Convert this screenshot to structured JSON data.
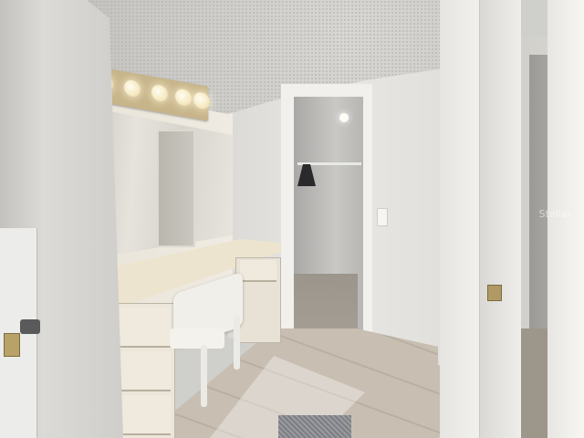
{
  "scene": {
    "description_type": "photo",
    "colors": {
      "ceiling": "#c9c8c4",
      "walls": "#e3e1dd",
      "vanity": "#ede4cf",
      "floor_tile": "#c6bdb0",
      "light_bar": "#c7b48a",
      "bulb_glow": "#fffdf2",
      "door_hardware": "#b8a26a"
    }
  },
  "overlay": {
    "watermark": "Stellar"
  }
}
